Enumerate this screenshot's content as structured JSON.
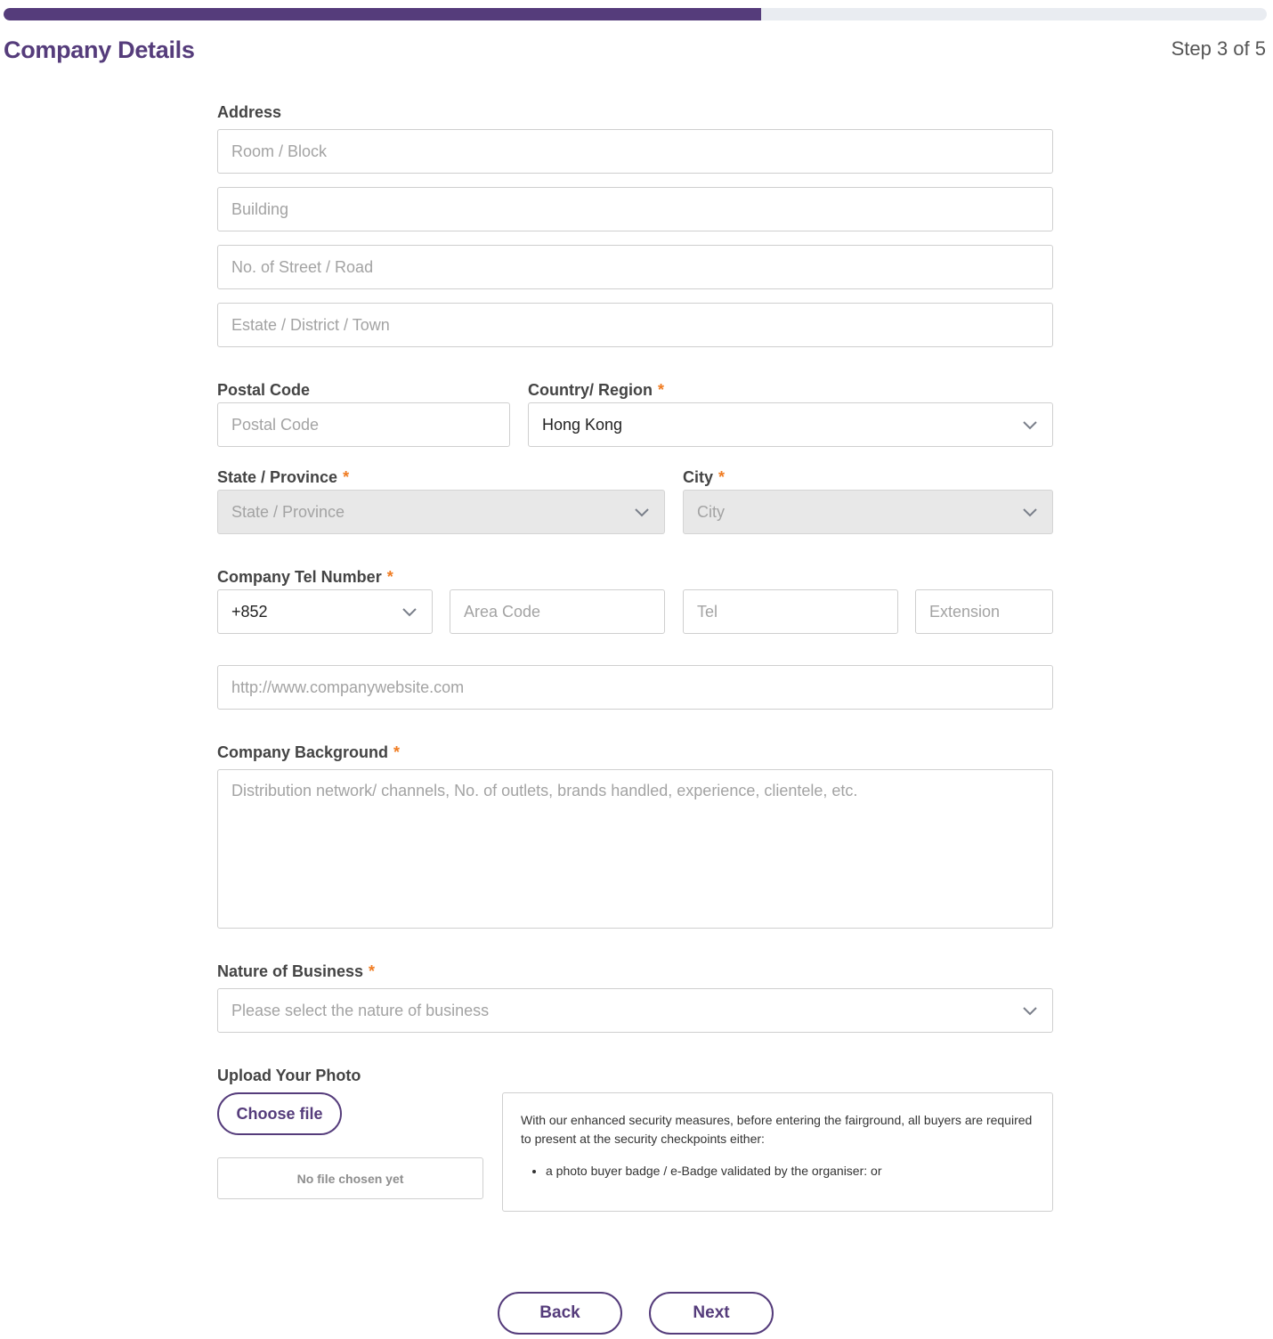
{
  "progress": {
    "fraction": 0.6
  },
  "header": {
    "title": "Company Details",
    "step": "Step 3 of 5"
  },
  "address": {
    "label": "Address",
    "room_placeholder": "Room / Block",
    "building_placeholder": "Building",
    "street_placeholder": "No. of Street / Road",
    "estate_placeholder": "Estate / District / Town"
  },
  "postal": {
    "label": "Postal Code",
    "placeholder": "Postal Code"
  },
  "country": {
    "label": "Country/ Region",
    "required": "*",
    "value": "Hong Kong"
  },
  "state": {
    "label": "State / Province",
    "required": "*",
    "placeholder": "State / Province"
  },
  "city": {
    "label": "City",
    "required": "*",
    "placeholder": "City"
  },
  "tel": {
    "label": "Company Tel Number",
    "required": "*",
    "country_code": "+852",
    "area_placeholder": "Area Code",
    "tel_placeholder": "Tel",
    "ext_placeholder": "Extension"
  },
  "website": {
    "placeholder": "http://www.companywebsite.com"
  },
  "background": {
    "label": "Company Background",
    "required": "*",
    "placeholder": "Distribution network/ channels, No. of outlets, brands handled, experience, clientele, etc."
  },
  "nature": {
    "label": "Nature of Business",
    "required": "*",
    "placeholder": "Please select the nature of business"
  },
  "upload": {
    "label": "Upload Your Photo",
    "button": "Choose file",
    "status": "No file chosen yet",
    "info_text": "With our enhanced security measures, before entering the fairground, all buyers are required to present at the security checkpoints either:",
    "info_items": [
      "a photo buyer badge / e-Badge validated by the organiser: or"
    ]
  },
  "nav": {
    "back": "Back",
    "next": "Next"
  },
  "colors": {
    "brand": "#553c7b",
    "required": "#f07c22",
    "disabled_bg": "#e8e8e8"
  }
}
